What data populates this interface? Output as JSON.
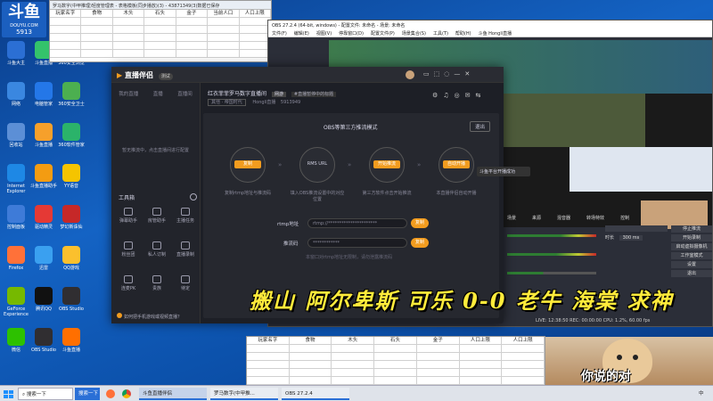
{
  "desktop": {
    "logo": "DOUYU.COM",
    "room_no": "5913",
    "icons": [
      {
        "label": "斗鱼大主",
        "color": "#2b6fd4"
      },
      {
        "label": "斗鱼直播",
        "color": "#34c36b"
      },
      {
        "label": "360安全浏览",
        "color": "#1fa04a"
      },
      {
        "label": "网络",
        "color": "#3a87e0"
      },
      {
        "label": "电脑管家",
        "color": "#2477e8"
      },
      {
        "label": "360安全卫士",
        "color": "#4caf50"
      },
      {
        "label": "回收站",
        "color": "#5c8fd6"
      },
      {
        "label": "斗鱼直播",
        "color": "#f6a02b"
      },
      {
        "label": "360软件管家",
        "color": "#2bb36a"
      },
      {
        "label": "Internet Explorer",
        "color": "#1e88e5"
      },
      {
        "label": "斗鱼直播助手",
        "color": "#f39c12"
      },
      {
        "label": "YY语音",
        "color": "#f5c400"
      },
      {
        "label": "控制面板",
        "color": "#3e7bd8"
      },
      {
        "label": "驱动精灵",
        "color": "#e53935"
      },
      {
        "label": "梦幻新诛仙",
        "color": "#c62828"
      },
      {
        "label": "Firefox",
        "color": "#ff7139"
      },
      {
        "label": "迅雷",
        "color": "#3aa0f0"
      },
      {
        "label": "QQ游戏",
        "color": "#fbc02d"
      },
      {
        "label": "GeForce Experience",
        "color": "#76b900"
      },
      {
        "label": "腾讯QQ",
        "color": "#111111"
      },
      {
        "label": "OBS Studio",
        "color": "#302e31"
      },
      {
        "label": "微信",
        "color": "#2dc100"
      },
      {
        "label": "OBS Studio",
        "color": "#302e31"
      },
      {
        "label": "斗鱼直播",
        "color": "#ff6f00"
      }
    ]
  },
  "excel_top": {
    "title": "罗马数字(中甲推理)轻度管理表 - 表格模板(同步播放)(3) - 43871349(3)数据已保存",
    "headers": [
      "玩家名字",
      "食物",
      "木头",
      "石头",
      "金子",
      "当前人口",
      "人口上限"
    ]
  },
  "excel_bottom": {
    "headers": [
      "玩家名字",
      "食物",
      "木头",
      "石头",
      "金子",
      "人口上限",
      "人口上限"
    ]
  },
  "obs": {
    "title": "OBS 27.2.4 (64-bit, windows) - 配置文件: 未命名 - 场景: 未命名",
    "menu": [
      "文件(F)",
      "编辑(E)",
      "视图(V)",
      "停靠窗口(D)",
      "配置文件(P)",
      "场景集合(S)",
      "工具(T)",
      "帮助(H)",
      "斗鱼 Hongli直播"
    ],
    "panels": [
      "场景",
      "来源",
      "混音器",
      "转场特效",
      "控制"
    ],
    "controls": [
      "停止推流",
      "开始录制",
      "启动虚拟摄像机",
      "工作室模式",
      "设置",
      "退出"
    ],
    "status": "LIVE: 12:38:50   REC: 00:00:00   CPU: 1.2%, 60.00 fps",
    "duration_label": "时长",
    "duration_value": "300 ms"
  },
  "app": {
    "brand": "直播伴侣",
    "version": "测试",
    "tabs": [
      "我的直播",
      "直播",
      "直播间"
    ],
    "room_title": "红衣菲菲罗马数字直播间",
    "room_tag": "网游",
    "room_announce": "#直播暂停中的标题",
    "category_label": "其他 · 帝国时代",
    "streamer": "Hongli直播",
    "room_id": "5913949",
    "placeholder_left": "暂无推流中，点击直播间进行配置",
    "tools_title": "工具箱",
    "tools": [
      "弹幕助手",
      "房管助手",
      "主播任务",
      "粉丝团",
      "私人订制",
      "直播录制",
      "连麦PK",
      "贵族",
      "待定"
    ],
    "notice": "如何把手机游戏或视频直播？",
    "mode_title": "OBS等第三方推流模式",
    "exit": "退出",
    "steps": [
      {
        "btn": "复制",
        "desc": "复制rtmp地址与推流码"
      },
      {
        "btn": "RMS URL",
        "desc": "填入OBS推流设置中的对应位置"
      },
      {
        "btn": "开始推流",
        "desc": "第三方软件点击开始推流"
      },
      {
        "btn": "自动开播",
        "desc": "本直播伴侣自动开播"
      }
    ],
    "rtmp_label": "rtmp地址",
    "rtmp_value": "rtmp://**********************",
    "key_label": "推流码",
    "key_value": "************",
    "copy": "复制",
    "footer_hint": "本窗口对rtmp地址无限制，请勿泄露推流码",
    "tooltip": "斗鱼平台开播成功"
  },
  "banner": "搬山 阿尔卑斯 可乐 0-0 老牛 海棠 求神",
  "meme_caption": "你说的对",
  "taskbar": {
    "search": "搜索一下",
    "items": [
      "斗鱼直播伴侣",
      "罗马数字(中甲推...",
      "OBS 27.2.4"
    ],
    "tray": "中"
  }
}
